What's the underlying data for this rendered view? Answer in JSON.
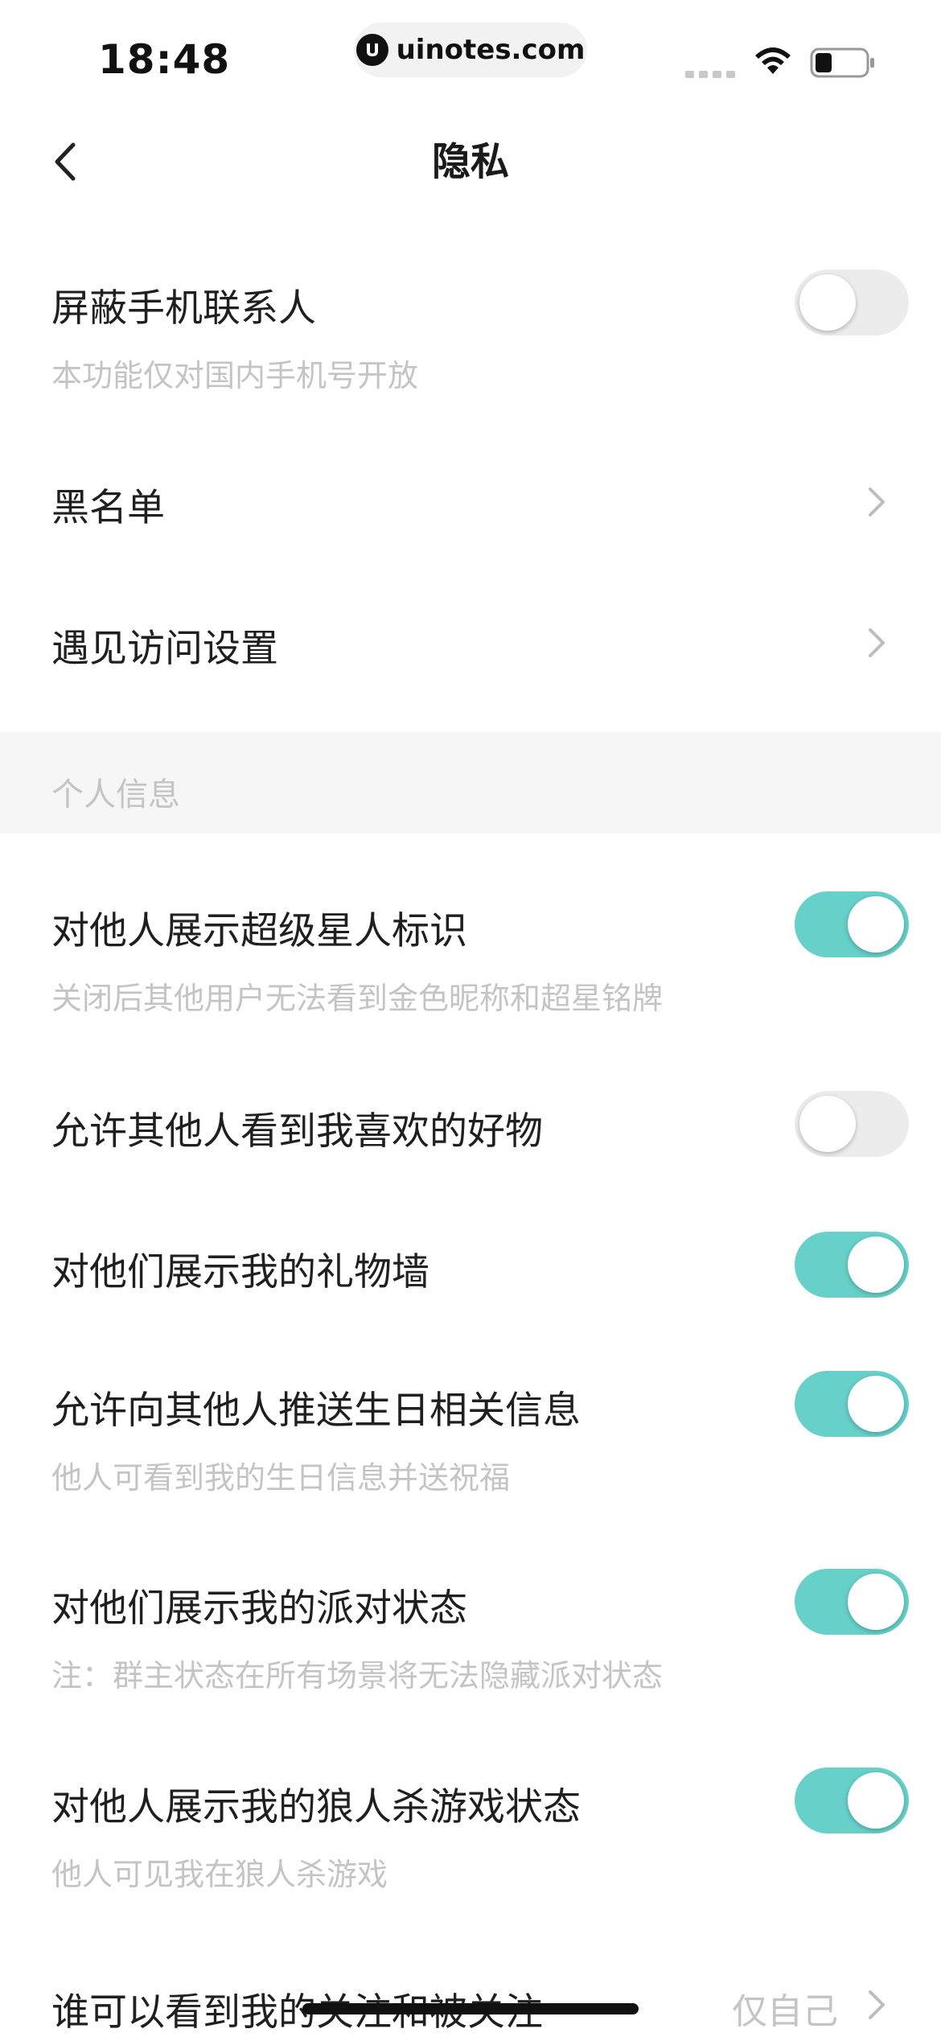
{
  "status_bar": {
    "time": "18:48",
    "url": "uinotes.com"
  },
  "nav": {
    "title": "隐私",
    "back_icon": "chevron-left-icon"
  },
  "rows": {
    "block_contacts": {
      "title": "屏蔽手机联系人",
      "subtitle": "本功能仅对国内手机号开放",
      "toggle_on": false
    },
    "blacklist": {
      "title": "黑名单"
    },
    "encounter": {
      "title": "遇见访问设置"
    },
    "superstar": {
      "title": "对他人展示超级星人标识",
      "subtitle": "关闭后其他用户无法看到金色昵称和超星铭牌",
      "toggle_on": true
    },
    "liked_goods": {
      "title": "允许其他人看到我喜欢的好物",
      "toggle_on": false
    },
    "gift_wall": {
      "title": "对他们展示我的礼物墙",
      "toggle_on": true
    },
    "birthday": {
      "title": "允许向其他人推送生日相关信息",
      "subtitle": "他人可看到我的生日信息并送祝福",
      "toggle_on": true
    },
    "party_status": {
      "title": "对他们展示我的派对状态",
      "subtitle": "注：群主状态在所有场景将无法隐藏派对状态",
      "toggle_on": true
    },
    "werewolf": {
      "title": "对他人展示我的狼人杀游戏状态",
      "subtitle": "他人可见我在狼人杀游戏",
      "toggle_on": true
    },
    "follow_visibility": {
      "title": "谁可以看到我的关注和被关注",
      "value": "仅自己"
    }
  },
  "section": {
    "personal_info": "个人信息"
  },
  "colors": {
    "toggle_on": "#66d0c9",
    "toggle_off": "#ececec",
    "subtitle_text": "#c4c4c4",
    "section_bg": "#f6f6f6"
  }
}
